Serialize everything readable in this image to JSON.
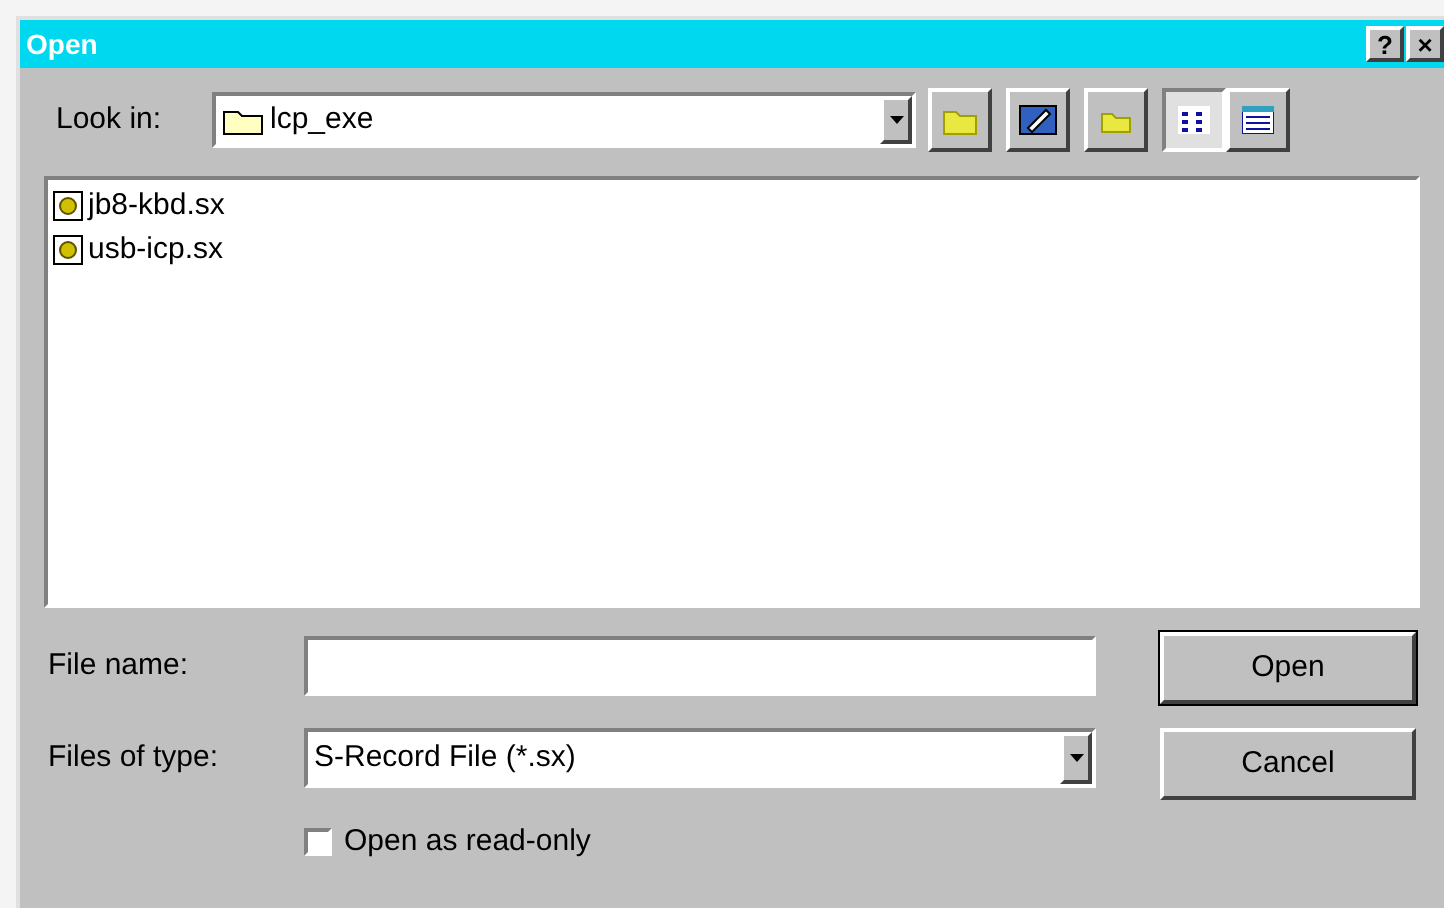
{
  "window": {
    "title": "Open",
    "title_buttons": [
      "?",
      "×"
    ]
  },
  "look_in": {
    "label": "Look in:",
    "value": "lcp_exe"
  },
  "toolbar": [
    {
      "kind": "up"
    },
    {
      "kind": "desktop"
    },
    {
      "kind": "new-folder"
    },
    {
      "kind": "list",
      "selected": true
    },
    {
      "kind": "details",
      "selected": false
    }
  ],
  "files": [
    {
      "name": "jb8-kbd.sx"
    },
    {
      "name": "usb-icp.sx"
    }
  ],
  "file_name": {
    "label": "File name:"
  },
  "file_type": {
    "label": "Files of type:",
    "value": "S-Record File (*.sx)"
  },
  "buttons": [
    {
      "label": "Open",
      "default": true
    },
    {
      "label": "Cancel",
      "default": false
    }
  ],
  "read_only": {
    "label": "Open as read-only",
    "checked": false
  }
}
